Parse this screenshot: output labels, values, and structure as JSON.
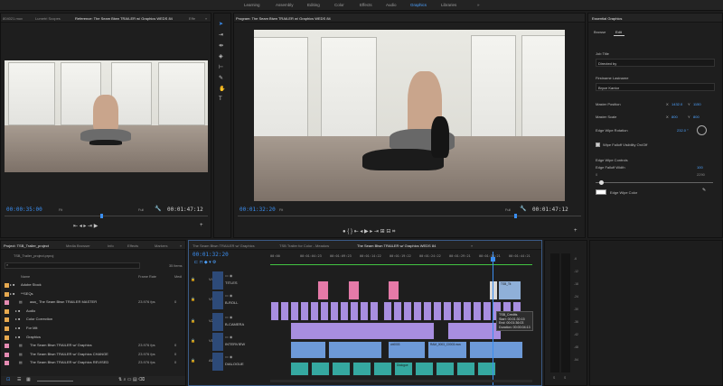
{
  "workspaces": [
    "Learning",
    "Assembly",
    "Editing",
    "Color",
    "Effects",
    "Audio",
    "Graphics",
    "Libraries"
  ],
  "active_workspace": "Graphics",
  "source_panel": {
    "tabs": [
      "804021.mov",
      "Lumetri Scopes",
      "Reference: The Seam Btwn TRAILER w/ Graphics WEDS 84",
      "Effe"
    ],
    "timecode_left": "00:00:35:00",
    "fit_label": "Fit",
    "full_label": "Full",
    "timecode_right": "00:01:47:12"
  },
  "program_panel": {
    "tab": "Program: The Seam Btwn TRAILER w/ Graphics WEDS 84",
    "timecode_left": "00:01:32:20",
    "fit_label": "Fit",
    "full_label": "Full",
    "timecode_right": "00:01:47:12"
  },
  "essential_graphics": {
    "title": "Essential Graphics",
    "tab_browse": "Browse",
    "tab_edit": "Edit",
    "job_title_label": "Job Title",
    "job_title_value": "Directed by",
    "name_label": "Firstname Lastname",
    "name_value": "Bryce Kantor",
    "master_position_label": "Master Position",
    "master_position_x": "1432.0",
    "master_position_y": "1150",
    "master_scale_label": "Master Scale",
    "master_scale_x": "800",
    "master_scale_y": "800",
    "edge_wipe_rotation_label": "Edge Wipe Rotation",
    "edge_wipe_rotation_value": "232.0 °",
    "wipe_falloff_label": "Wipe Falloff Visibility On/Off",
    "edge_wipe_controls_label": "Edge Wipe Controls",
    "edge_falloff_width_label": "Edge Falloff Width",
    "edge_falloff_width_value": "100",
    "slider_min": "0",
    "slider_max": "2290",
    "edge_wipe_color_label": "Edge Wipe Color"
  },
  "project_panel": {
    "tabs": [
      "Project: TSB_Trailer_project",
      "Media Browser",
      "Info",
      "Effects",
      "Markers"
    ],
    "project_file": "TSB_Trailer_project.prproj",
    "item_count": "35 Items",
    "col_name": "Name",
    "col_frame_rate": "Frame Rate",
    "col_media": "Medi",
    "items": [
      {
        "name": "Adobe Stock",
        "fps": "",
        "media": "",
        "color": "#e6a94f"
      },
      {
        "name": "**SEQs",
        "fps": "",
        "media": "",
        "color": "#e6a94f"
      },
      {
        "name": "aaa_ The Seam Btwn TRAILER MASTER",
        "fps": "23.976 fps",
        "media": "0",
        "color": "#e58bb3"
      },
      {
        "name": "Audio",
        "fps": "",
        "media": "",
        "color": "#e6a94f"
      },
      {
        "name": "Color Correction",
        "fps": "",
        "media": "",
        "color": "#e6a94f"
      },
      {
        "name": "For Mit",
        "fps": "",
        "media": "",
        "color": "#e6a94f"
      },
      {
        "name": "Graphics",
        "fps": "",
        "media": "",
        "color": "#e6a94f"
      },
      {
        "name": "The Seam Btwn TRAILER w/ Graphics",
        "fps": "23.976 fps",
        "media": "0",
        "color": "#e58bb3"
      },
      {
        "name": "The Seam Btwn TRAILER w/ Graphics CHANGE",
        "fps": "23.976 fps",
        "media": "0",
        "color": "#e58bb3"
      },
      {
        "name": "The Seam Btwn TRAILER w/ Graphics REVISED",
        "fps": "23.976 fps",
        "media": "0",
        "color": "#e58bb3"
      }
    ]
  },
  "timeline": {
    "tabs": [
      "The Seam Btwn TRAILER w/ Graphics",
      "TSB Trailer for Color - Meadow",
      "The Seam Btwn TRAILER w/ Graphics WEDS 84"
    ],
    "timecode": "00:01:32:20",
    "ruler": [
      "00:00",
      "00:01:04:23",
      "00:01:09:23",
      "00:01:14:22",
      "00:01:19:22",
      "00:01:24:22",
      "00:01:29:21",
      "00:01:34:21",
      "00:01:44:21"
    ],
    "tracks": [
      {
        "id": "V4",
        "label": "TITLES"
      },
      {
        "id": "V3",
        "label": "B-ROLL"
      },
      {
        "id": "V2",
        "label": "B-CAMERA"
      },
      {
        "id": "V1",
        "label": "INTERVIEW"
      },
      {
        "id": "A1",
        "label": "DIALOGUE"
      }
    ],
    "tooltip": {
      "name": "TSB_Credits",
      "start": "Start: 00:01:30:15",
      "end": "End: 00:01:36:03",
      "duration": "Duration: 00:00:04:13"
    },
    "clip_labels": {
      "credits": "TSB_Tit",
      "v1a": "cb0003",
      "v1b": "RAM_0003_C0003.mov",
      "a1": "Dialogue"
    }
  },
  "audio_meter": {
    "ticks": [
      "-6",
      "-12",
      "-18",
      "-24",
      "-30",
      "-36",
      "-42",
      "-48",
      "-54"
    ],
    "bottom": [
      "S",
      "S"
    ]
  },
  "colors": {
    "accent": "#3b8ef0",
    "clip_purple": "#a88ee0",
    "clip_pink": "#e57aa8",
    "clip_blue": "#6d9ad8",
    "clip_teal": "#35a8a0"
  }
}
